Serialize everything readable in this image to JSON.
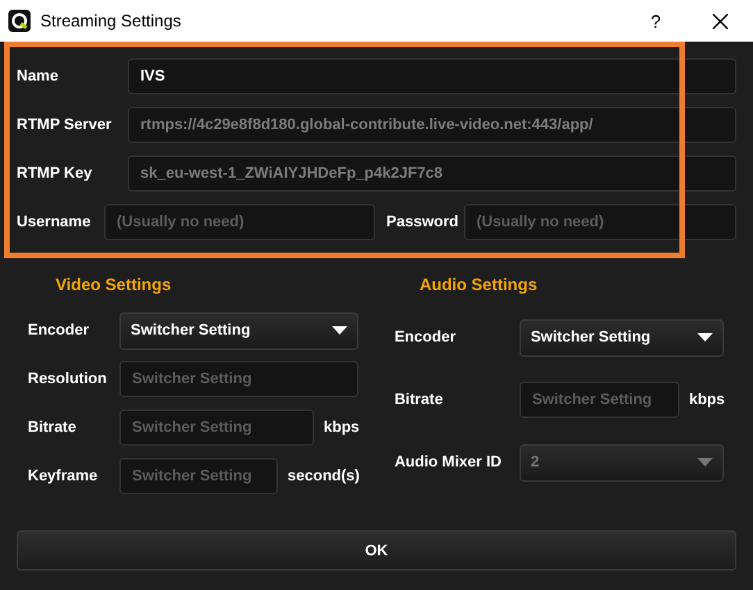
{
  "window": {
    "title": "Streaming Settings",
    "help": "?"
  },
  "connection": {
    "name": {
      "label": "Name",
      "value": "IVS",
      "disabled": false
    },
    "server": {
      "label": "RTMP Server",
      "value": "rtmps://4c29e8f8d180.global-contribute.live-video.net:443/app/",
      "disabled": true
    },
    "key": {
      "label": "RTMP Key",
      "value": "sk_eu-west-1_ZWiAIYJHDeFp_p4k2JF7c8",
      "disabled": true
    },
    "username": {
      "label": "Username",
      "placeholder": "(Usually no need)"
    },
    "password": {
      "label": "Password",
      "placeholder": "(Usually no need)"
    }
  },
  "video": {
    "title": "Video Settings",
    "rows": [
      {
        "kind": "select",
        "label": "Encoder",
        "value": "Switcher Setting",
        "disabled": false
      },
      {
        "kind": "field",
        "label": "Resolution",
        "placeholder": "Switcher Setting"
      },
      {
        "kind": "field",
        "label": "Bitrate",
        "placeholder": "Switcher Setting",
        "unit": "kbps"
      },
      {
        "kind": "field",
        "label": "Keyframe",
        "placeholder": "Switcher Setting",
        "unit": "second(s)"
      }
    ]
  },
  "audio": {
    "title": "Audio Settings",
    "rows": [
      {
        "kind": "select",
        "label": "Encoder",
        "value": "Switcher Setting",
        "disabled": false
      },
      {
        "kind": "field",
        "label": "Bitrate",
        "placeholder": "Switcher Setting",
        "unit": "kbps"
      },
      {
        "kind": "select",
        "label": "Audio Mixer ID",
        "value": "2",
        "disabled": true
      }
    ]
  },
  "ok_button": "OK"
}
